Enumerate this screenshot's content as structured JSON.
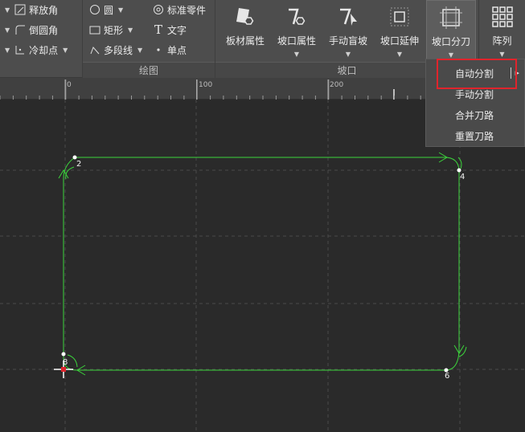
{
  "ribbon": {
    "modify": {
      "items": [
        {
          "label": "释放角",
          "icon": "release-corner-icon"
        },
        {
          "label": "倒圆角",
          "icon": "fillet-icon"
        },
        {
          "label": "冷却点",
          "icon": "cooling-point-icon"
        }
      ]
    },
    "draw": {
      "group_label": "绘图",
      "col1": [
        {
          "label": "圆",
          "icon": "circle-icon"
        },
        {
          "label": "矩形",
          "icon": "rectangle-icon"
        },
        {
          "label": "多段线",
          "icon": "polyline-icon"
        }
      ],
      "col2": [
        {
          "label": "标准零件",
          "icon": "standard-part-icon"
        },
        {
          "label": "文字",
          "icon": "text-icon"
        },
        {
          "label": "单点",
          "icon": "single-point-icon"
        }
      ]
    },
    "bevel": {
      "group_label": "坡口",
      "buttons": [
        {
          "label": "板材属性",
          "icon": "sheet-properties-icon"
        },
        {
          "label": "坡口属性",
          "icon": "bevel-properties-icon"
        },
        {
          "label": "手动盲坡",
          "icon": "manual-blind-bevel-icon"
        },
        {
          "label": "坡口延伸",
          "icon": "bevel-extend-icon"
        },
        {
          "label": "坡口分刀",
          "icon": "bevel-split-icon"
        }
      ]
    },
    "array": {
      "label": "阵列",
      "icon": "array-grid-icon"
    }
  },
  "ruler": {
    "labels": [
      "0",
      "100",
      "200"
    ]
  },
  "dropdown": {
    "items": [
      "自动分割",
      "手动分割",
      "合并刀路",
      "重置刀路"
    ]
  },
  "canvas": {
    "point_labels": [
      "2",
      "4",
      "6",
      "8"
    ],
    "path_color": "#3cd43c",
    "grid_color": "#4a4a4a",
    "background": "#2a2a2a"
  }
}
